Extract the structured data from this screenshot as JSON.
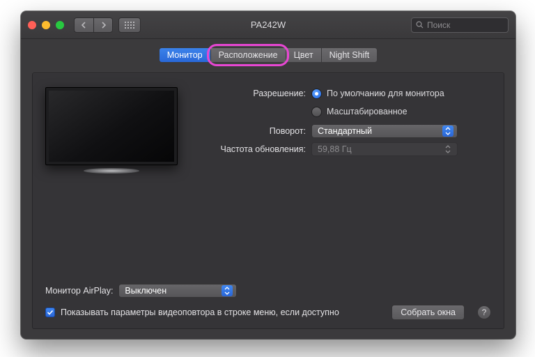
{
  "window": {
    "title": "PA242W"
  },
  "search": {
    "placeholder": "Поиск"
  },
  "tabs": [
    {
      "label": "Монитор",
      "active": true
    },
    {
      "label": "Расположение",
      "highlighted": true
    },
    {
      "label": "Цвет"
    },
    {
      "label": "Night Shift"
    }
  ],
  "settings": {
    "resolution_label": "Разрешение:",
    "resolution_options": {
      "default": "По умолчанию для монитора",
      "scaled": "Масштабированное"
    },
    "resolution_selected": "default",
    "rotation_label": "Поворот:",
    "rotation_value": "Стандартный",
    "refresh_label": "Частота обновления:",
    "refresh_value": "59,88 Гц"
  },
  "airplay": {
    "label": "Монитор AirPlay:",
    "value": "Выключен"
  },
  "footer": {
    "show_mirroring_label": "Показывать параметры видеоповтора в строке меню, если доступно",
    "show_mirroring_checked": true,
    "gather_windows": "Собрать окна",
    "help": "?"
  }
}
